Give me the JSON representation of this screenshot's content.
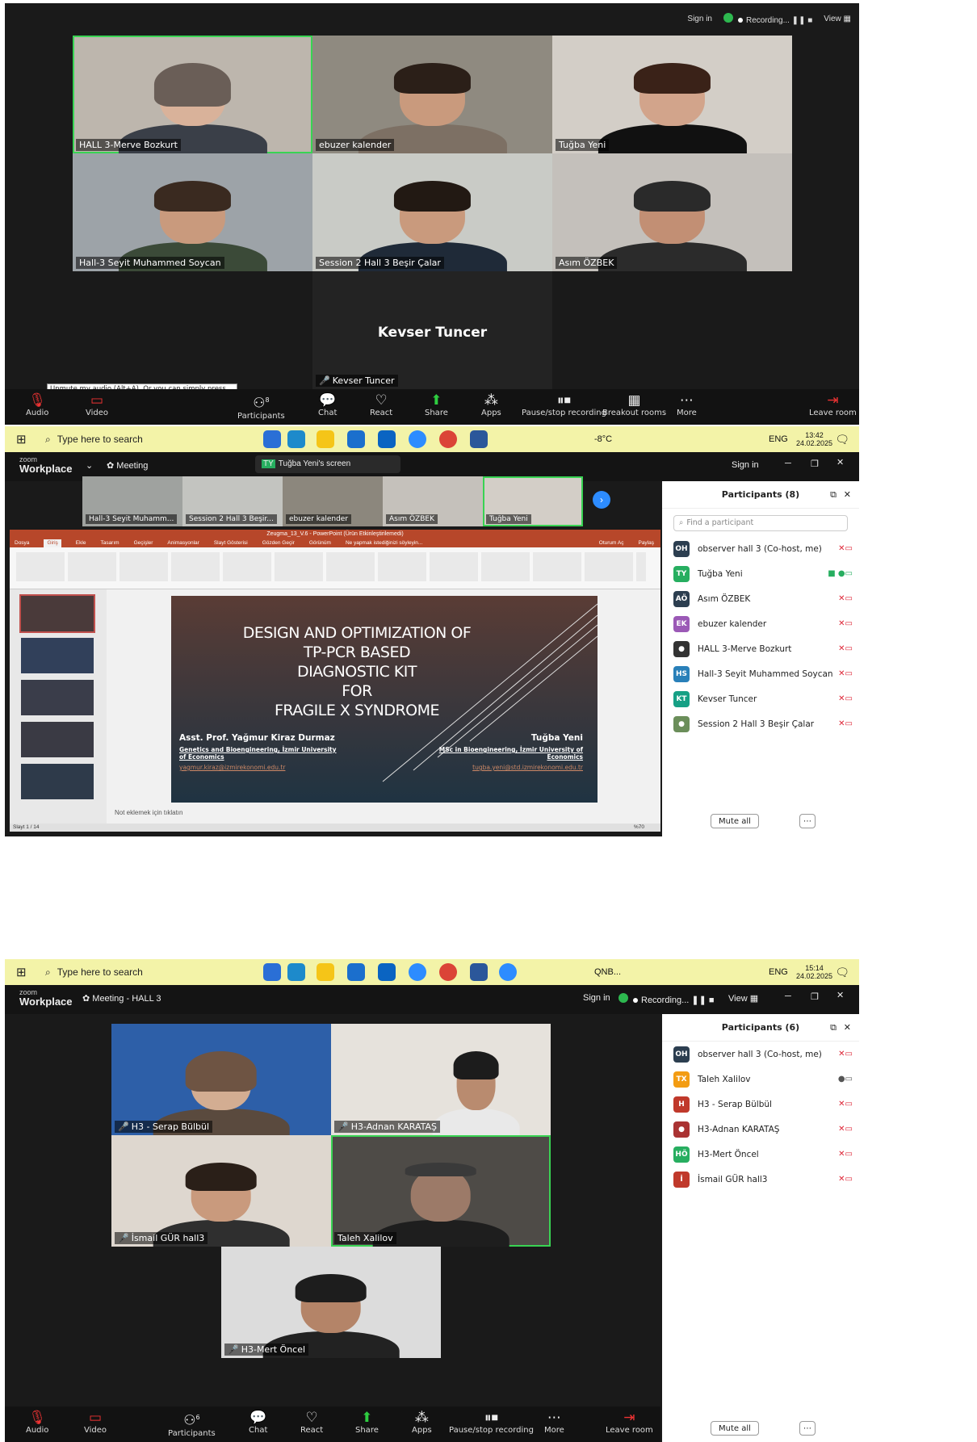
{
  "s1": {
    "top": {
      "sign_in": "Sign in",
      "recording": "Recording...",
      "view": "View"
    },
    "tiles": [
      "HALL 3-Merve Bozkurt",
      "ebuzer kalender",
      "Tuğba Yeni",
      "Hall-3 Seyit Muhammed Soycan",
      "Session 2 Hall 3 Beşir Çalar",
      "Asım ÖZBEK"
    ],
    "big_name": "Kevser Tuncer",
    "big_label": "Kevser Tuncer",
    "tooltip": "Unmute my audio (Alt+A). Or you can simply press and hold the Space bar to temporarily unmute.",
    "toolbar": {
      "audio": "Audio",
      "video": "Video",
      "participants": "Participants",
      "participants_count": "8",
      "chat": "Chat",
      "react": "React",
      "share": "Share",
      "apps": "Apps",
      "pause": "Pause/stop recording",
      "breakout": "Breakout rooms",
      "more": "More",
      "leave": "Leave room"
    }
  },
  "taskbar1": {
    "search": "Type here to search",
    "weather": "-8°C",
    "lang": "ENG",
    "time": "13:42",
    "date": "24.02.2025"
  },
  "s2": {
    "logo_a": "zoom",
    "logo_b": "Workplace",
    "meeting": "Meeting",
    "screen_label": "Tuğba Yeni's screen",
    "sign_in": "Sign in",
    "thumbs": [
      "Hall-3 Seyit Muhamm...",
      "Session 2 Hall 3 Beşir...",
      "ebuzer kalender",
      "Asım ÖZBEK",
      "Tuğba Yeni"
    ],
    "ppt_title": "Zeugma_13_V.6 - PowerPoint (Ürün Etkinleştirilemedi)",
    "ribbon_tabs": [
      "Dosya",
      "Giriş",
      "Ekle",
      "Tasarım",
      "Geçişler",
      "Animasyonlar",
      "Slayt Gösterisi",
      "Gözden Geçir",
      "Görünüm",
      "Ne yapmak istediğinizi söyleyin..."
    ],
    "ribbon_right": [
      "Oturum Aç",
      "Paylaş"
    ],
    "slide": {
      "title_lines": [
        "DESIGN AND OPTIMIZATION OF",
        "TP-PCR BASED",
        "DIAGNOSTIC KIT",
        "FOR",
        "FRAGILE X SYNDROME"
      ],
      "left_name": "Asst. Prof. Yağmur Kiraz Durmaz",
      "left_aff": "Genetics and Bioengineering, İzmir University of Economics",
      "left_email": "yagmur.kiraz@izmirekonomi.edu.tr",
      "right_name": "Tuğba Yeni",
      "right_aff": "MSc in Bioengineering, İzmir University of Economics",
      "right_email": "tugba.yeni@std.izmirekonomi.edu.tr"
    },
    "notes": "Not eklemek için tıklatın",
    "status": "Slayt 1 / 14",
    "zoom_level": "%70",
    "panel": {
      "title": "Participants (8)",
      "search_placeholder": "Find a participant",
      "mute_all": "Mute all",
      "rows": [
        {
          "ini": "OH",
          "color": "#2c3e50",
          "name": "observer hall 3 (Co-host, me)"
        },
        {
          "ini": "TY",
          "color": "#27ae60",
          "name": "Tuğba Yeni"
        },
        {
          "ini": "AÖ",
          "color": "#2c3e50",
          "name": "Asım ÖZBEK"
        },
        {
          "ini": "EK",
          "color": "#9b59b6",
          "name": "ebuzer kalender"
        },
        {
          "ini": "",
          "color": "#333333",
          "name": "HALL 3-Merve Bozkurt"
        },
        {
          "ini": "HS",
          "color": "#2980b9",
          "name": "Hall-3 Seyit Muhammed Soycan"
        },
        {
          "ini": "KT",
          "color": "#16a085",
          "name": "Kevser Tuncer"
        },
        {
          "ini": "",
          "color": "#6b8e5a",
          "name": "Session 2 Hall 3 Beşir Çalar"
        }
      ]
    }
  },
  "taskbar2": {
    "search": "Type here to search",
    "weather": "QNB...",
    "lang": "ENG",
    "time": "15:14",
    "date": "24.02.2025"
  },
  "s3": {
    "logo_a": "zoom",
    "logo_b": "Workplace",
    "meeting": "Meeting - HALL 3",
    "sign_in": "Sign in",
    "recording": "Recording...",
    "view": "View",
    "tiles": [
      "H3 - Serap Bülbül",
      "H3-Adnan KARATAŞ",
      "İsmail GÜR hall3",
      "Taleh Xalilov",
      "H3-Mert Öncel"
    ],
    "toolbar": {
      "audio": "Audio",
      "video": "Video",
      "participants": "Participants",
      "participants_count": "6",
      "chat": "Chat",
      "react": "React",
      "share": "Share",
      "apps": "Apps",
      "pause": "Pause/stop recording",
      "more": "More",
      "leave": "Leave room"
    },
    "panel": {
      "title": "Participants (6)",
      "mute_all": "Mute all",
      "rows": [
        {
          "ini": "OH",
          "color": "#2c3e50",
          "name": "observer hall 3 (Co-host, me)"
        },
        {
          "ini": "TX",
          "color": "#f39c12",
          "name": "Taleh Xalilov"
        },
        {
          "ini": "H",
          "color": "#c0392b",
          "name": "H3 - Serap Bülbül"
        },
        {
          "ini": "",
          "color": "#a33",
          "name": "H3-Adnan KARATAŞ"
        },
        {
          "ini": "HÖ",
          "color": "#27ae60",
          "name": "H3-Mert Öncel"
        },
        {
          "ini": "İ",
          "color": "#c0392b",
          "name": "İsmail GÜR hall3"
        }
      ]
    }
  }
}
